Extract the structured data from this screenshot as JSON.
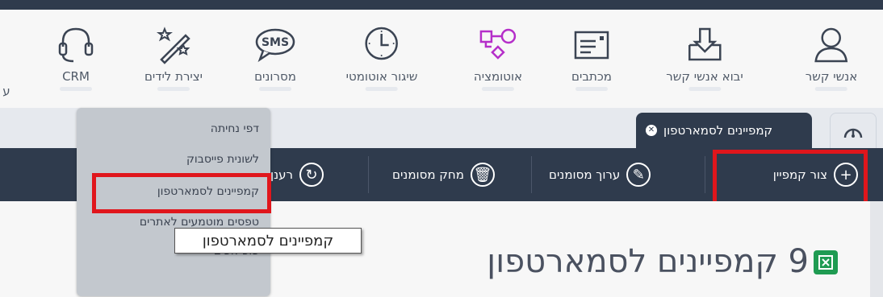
{
  "nav": {
    "items": [
      {
        "label": "אנשי קשר",
        "icon": "user-icon"
      },
      {
        "label": "יבוא אנשי קשר",
        "icon": "import-icon"
      },
      {
        "label": "מכתבים",
        "icon": "newsletter-icon"
      },
      {
        "label": "אוטומציה",
        "icon": "automation-icon"
      },
      {
        "label": "שיגור אוטומטי",
        "icon": "clock-icon"
      },
      {
        "label": "מסרונים",
        "icon": "sms-icon"
      },
      {
        "label": "יצירת לידים",
        "icon": "magic-wand-icon"
      },
      {
        "label": "CRM",
        "icon": "headset-icon"
      },
      {
        "label": "ע"
      }
    ]
  },
  "tabs": {
    "active_label": "קמפיינים לסמארטפון",
    "dashboard_icon": "speedometer-icon"
  },
  "toolbar": {
    "create": "צור קמפיין",
    "edit": "ערוך מסומנים",
    "delete": "מחק מסומנים",
    "refresh": "רענן"
  },
  "dropdown": {
    "items": [
      "דפי נחיתה",
      "לשונית פייסבוק",
      "קמפיינים לסמארטפון",
      "טפסים מוטמעים לאתרים",
      "פופ אפים"
    ]
  },
  "tooltip": "קמפיינים לסמארטפון",
  "page": {
    "count": "9",
    "title": "קמפיינים לסמארטפון",
    "export_icon": "excel-icon"
  },
  "colors": {
    "dark": "#2f3b4d",
    "highlight": "#e0161c",
    "excel": "#1f9b52"
  }
}
